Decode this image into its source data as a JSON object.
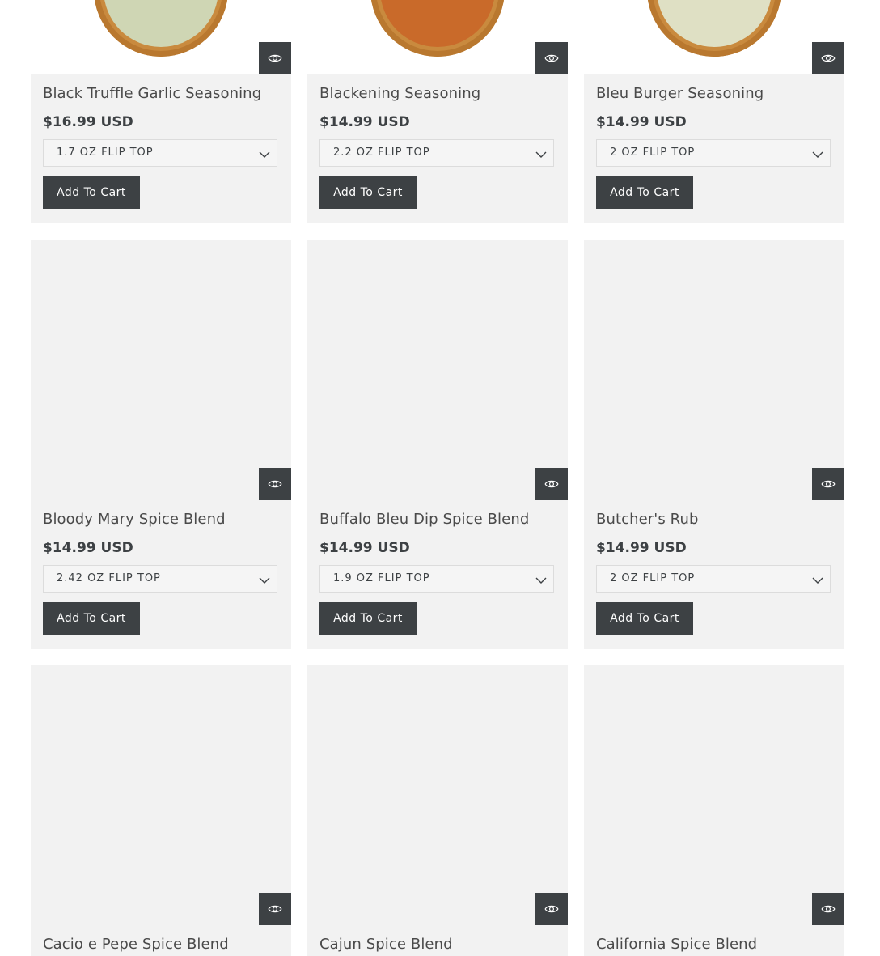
{
  "products": [
    {
      "title": "Black Truffle Garlic Seasoning",
      "price": "$16.99 USD",
      "variant": "1.7 OZ FLIP TOP",
      "cart_label": "Add To Cart",
      "image_color": "#cfd6b4"
    },
    {
      "title": "Blackening Seasoning",
      "price": "$14.99 USD",
      "variant": "2.2 OZ FLIP TOP",
      "cart_label": "Add To Cart",
      "image_color": "#c96a2a"
    },
    {
      "title": "Bleu Burger Seasoning",
      "price": "$14.99 USD",
      "variant": "2 OZ FLIP TOP",
      "cart_label": "Add To Cart",
      "image_color": "#dfe0c4"
    },
    {
      "title": "Bloody Mary Spice Blend",
      "price": "$14.99 USD",
      "variant": "2.42 OZ FLIP TOP",
      "cart_label": "Add To Cart"
    },
    {
      "title": "Buffalo Bleu Dip Spice Blend",
      "price": "$14.99 USD",
      "variant": "1.9 OZ FLIP TOP",
      "cart_label": "Add To Cart"
    },
    {
      "title": "Butcher's Rub",
      "price": "$14.99 USD",
      "variant": "2 OZ FLIP TOP",
      "cart_label": "Add To Cart"
    },
    {
      "title": "Cacio e Pepe Spice Blend"
    },
    {
      "title": "Cajun Spice Blend"
    },
    {
      "title": "California Spice Blend"
    }
  ],
  "icons": {
    "quick_view": "eye-icon",
    "variant_dropdown": "chevron-down-icon"
  },
  "colors": {
    "button_bg": "#3d4144",
    "card_bg": "#f2f2f2"
  }
}
